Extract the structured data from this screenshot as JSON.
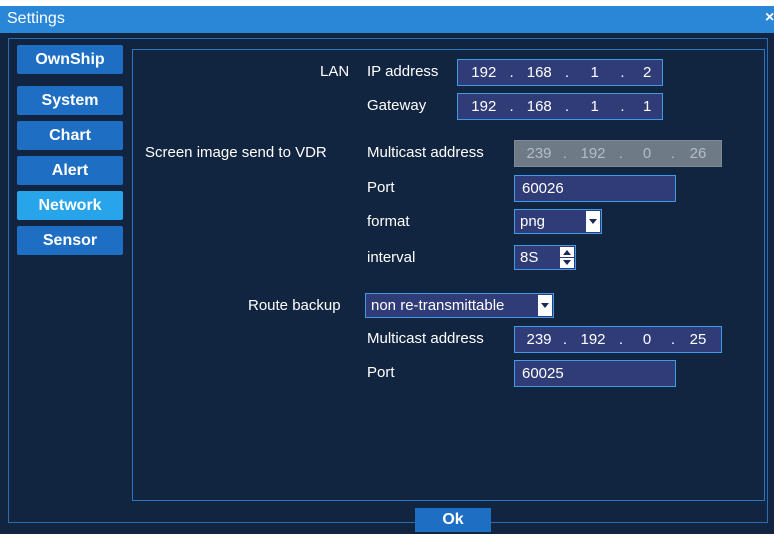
{
  "window": {
    "title": "Settings",
    "close_glyph": "×"
  },
  "sidebar": {
    "items": [
      {
        "label": "OwnShip"
      },
      {
        "label": "System"
      },
      {
        "label": "Chart"
      },
      {
        "label": "Alert"
      },
      {
        "label": "Network",
        "active": true
      },
      {
        "label": "Sensor"
      }
    ]
  },
  "lan": {
    "label": "LAN",
    "ip_label": "IP address",
    "ip": [
      "192",
      "168",
      "1",
      "2"
    ],
    "gateway_label": "Gateway",
    "gateway": [
      "192",
      "168",
      "1",
      "1"
    ]
  },
  "vdr": {
    "label": "Screen image send to VDR",
    "multicast_label": "Multicast address",
    "multicast": [
      "239",
      "192",
      "0",
      "26"
    ],
    "port_label": "Port",
    "port": "60026",
    "format_label": "format",
    "format": "png",
    "interval_label": "interval",
    "interval": "8S"
  },
  "route": {
    "label": "Route backup",
    "mode": "non re-transmittable",
    "multicast_label": "Multicast address",
    "multicast": [
      "239",
      "192",
      "0",
      "25"
    ],
    "port_label": "Port",
    "port": "60025"
  },
  "footer": {
    "ok_label": "Ok"
  },
  "colors": {
    "background": "#122540",
    "titlebar": "#2a86d6",
    "nav_button": "#1e6fc4",
    "nav_active": "#27a4ea",
    "field": "#303c78",
    "field_border": "#3f9be5",
    "disabled_field": "#6e7a86"
  }
}
